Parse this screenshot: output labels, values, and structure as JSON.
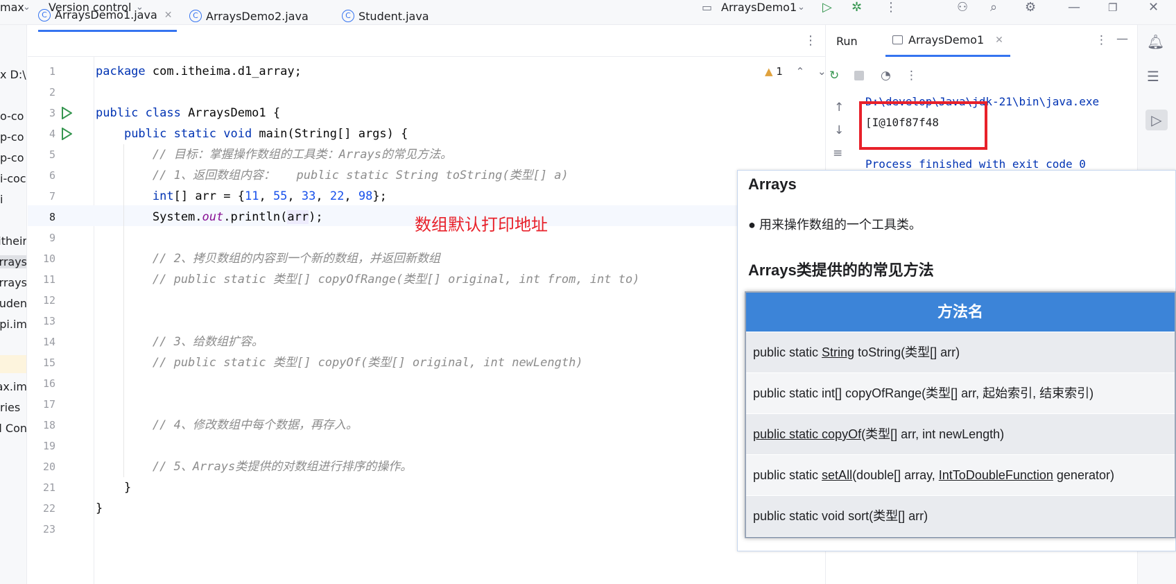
{
  "titlebar": {
    "project_name": "max",
    "vcs_label": "Version control",
    "run_config": "ArraysDemo1"
  },
  "project_tree": {
    "path_hint": "x D:\\",
    "items": [
      "o-co",
      "p-co",
      "p-co",
      "i-coc",
      "i",
      "itheir",
      "rrays",
      "rrays",
      "tuden",
      "api.im",
      "max.im",
      "ries",
      "d Con"
    ]
  },
  "editor": {
    "tabs": [
      {
        "label": "ArraysDemo1.java",
        "active": true,
        "closable": true
      },
      {
        "label": "ArraysDemo2.java",
        "active": false,
        "closable": false
      },
      {
        "label": "Student.java",
        "active": false,
        "closable": false
      }
    ],
    "warning_count": "1",
    "current_line": "8",
    "lines": [
      "package com.itheima.d1_array;",
      "",
      "public class ArraysDemo1 {",
      "    public static void main(String[] args) {",
      "        // 目标：掌握操作数组的工具类：Arrays的常见方法。",
      "        // 1、返回数组内容：   public static String toString(类型[] a)",
      "        int[] arr = {11, 55, 33, 22, 98};",
      "        System.out.println(arr);",
      "",
      "        // 2、拷贝数组的内容到一个新的数组，并返回新数组",
      "        // public static 类型[] copyOfRange(类型[] original, int from, int to)",
      "",
      "",
      "        // 3、给数组扩容。",
      "        // public static 类型[] copyOf(类型[] original, int newLength)",
      "",
      "",
      "        // 4、修改数组中每个数据，再存入。",
      "",
      "        // 5、Arrays类提供的对数组进行排序的操作。",
      "    }",
      "}",
      ""
    ]
  },
  "annotation": "数组默认打印地址",
  "run_panel": {
    "label": "Run",
    "tab": "ArraysDemo1",
    "console": {
      "command": "D:\\develop\\Java\\jdk-21\\bin\\java.exe",
      "output": "[I@10f87f48",
      "exit": "Process finished with exit code 0"
    }
  },
  "slide": {
    "title": "Arrays",
    "bullet": "用来操作数组的一个工具类。",
    "subtitle": "Arrays类提供的的常见方法",
    "table_header": "方法名",
    "methods": [
      "public static String toString(类型[] arr)",
      "public static int[] copyOfRange(类型[] arr, 起始索引, 结束索引)",
      "public static copyOf(类型[] arr, int newLength)",
      "public static setAll(double[] array, IntToDoubleFunction generator)",
      "public static void sort(类型[] arr)"
    ]
  }
}
